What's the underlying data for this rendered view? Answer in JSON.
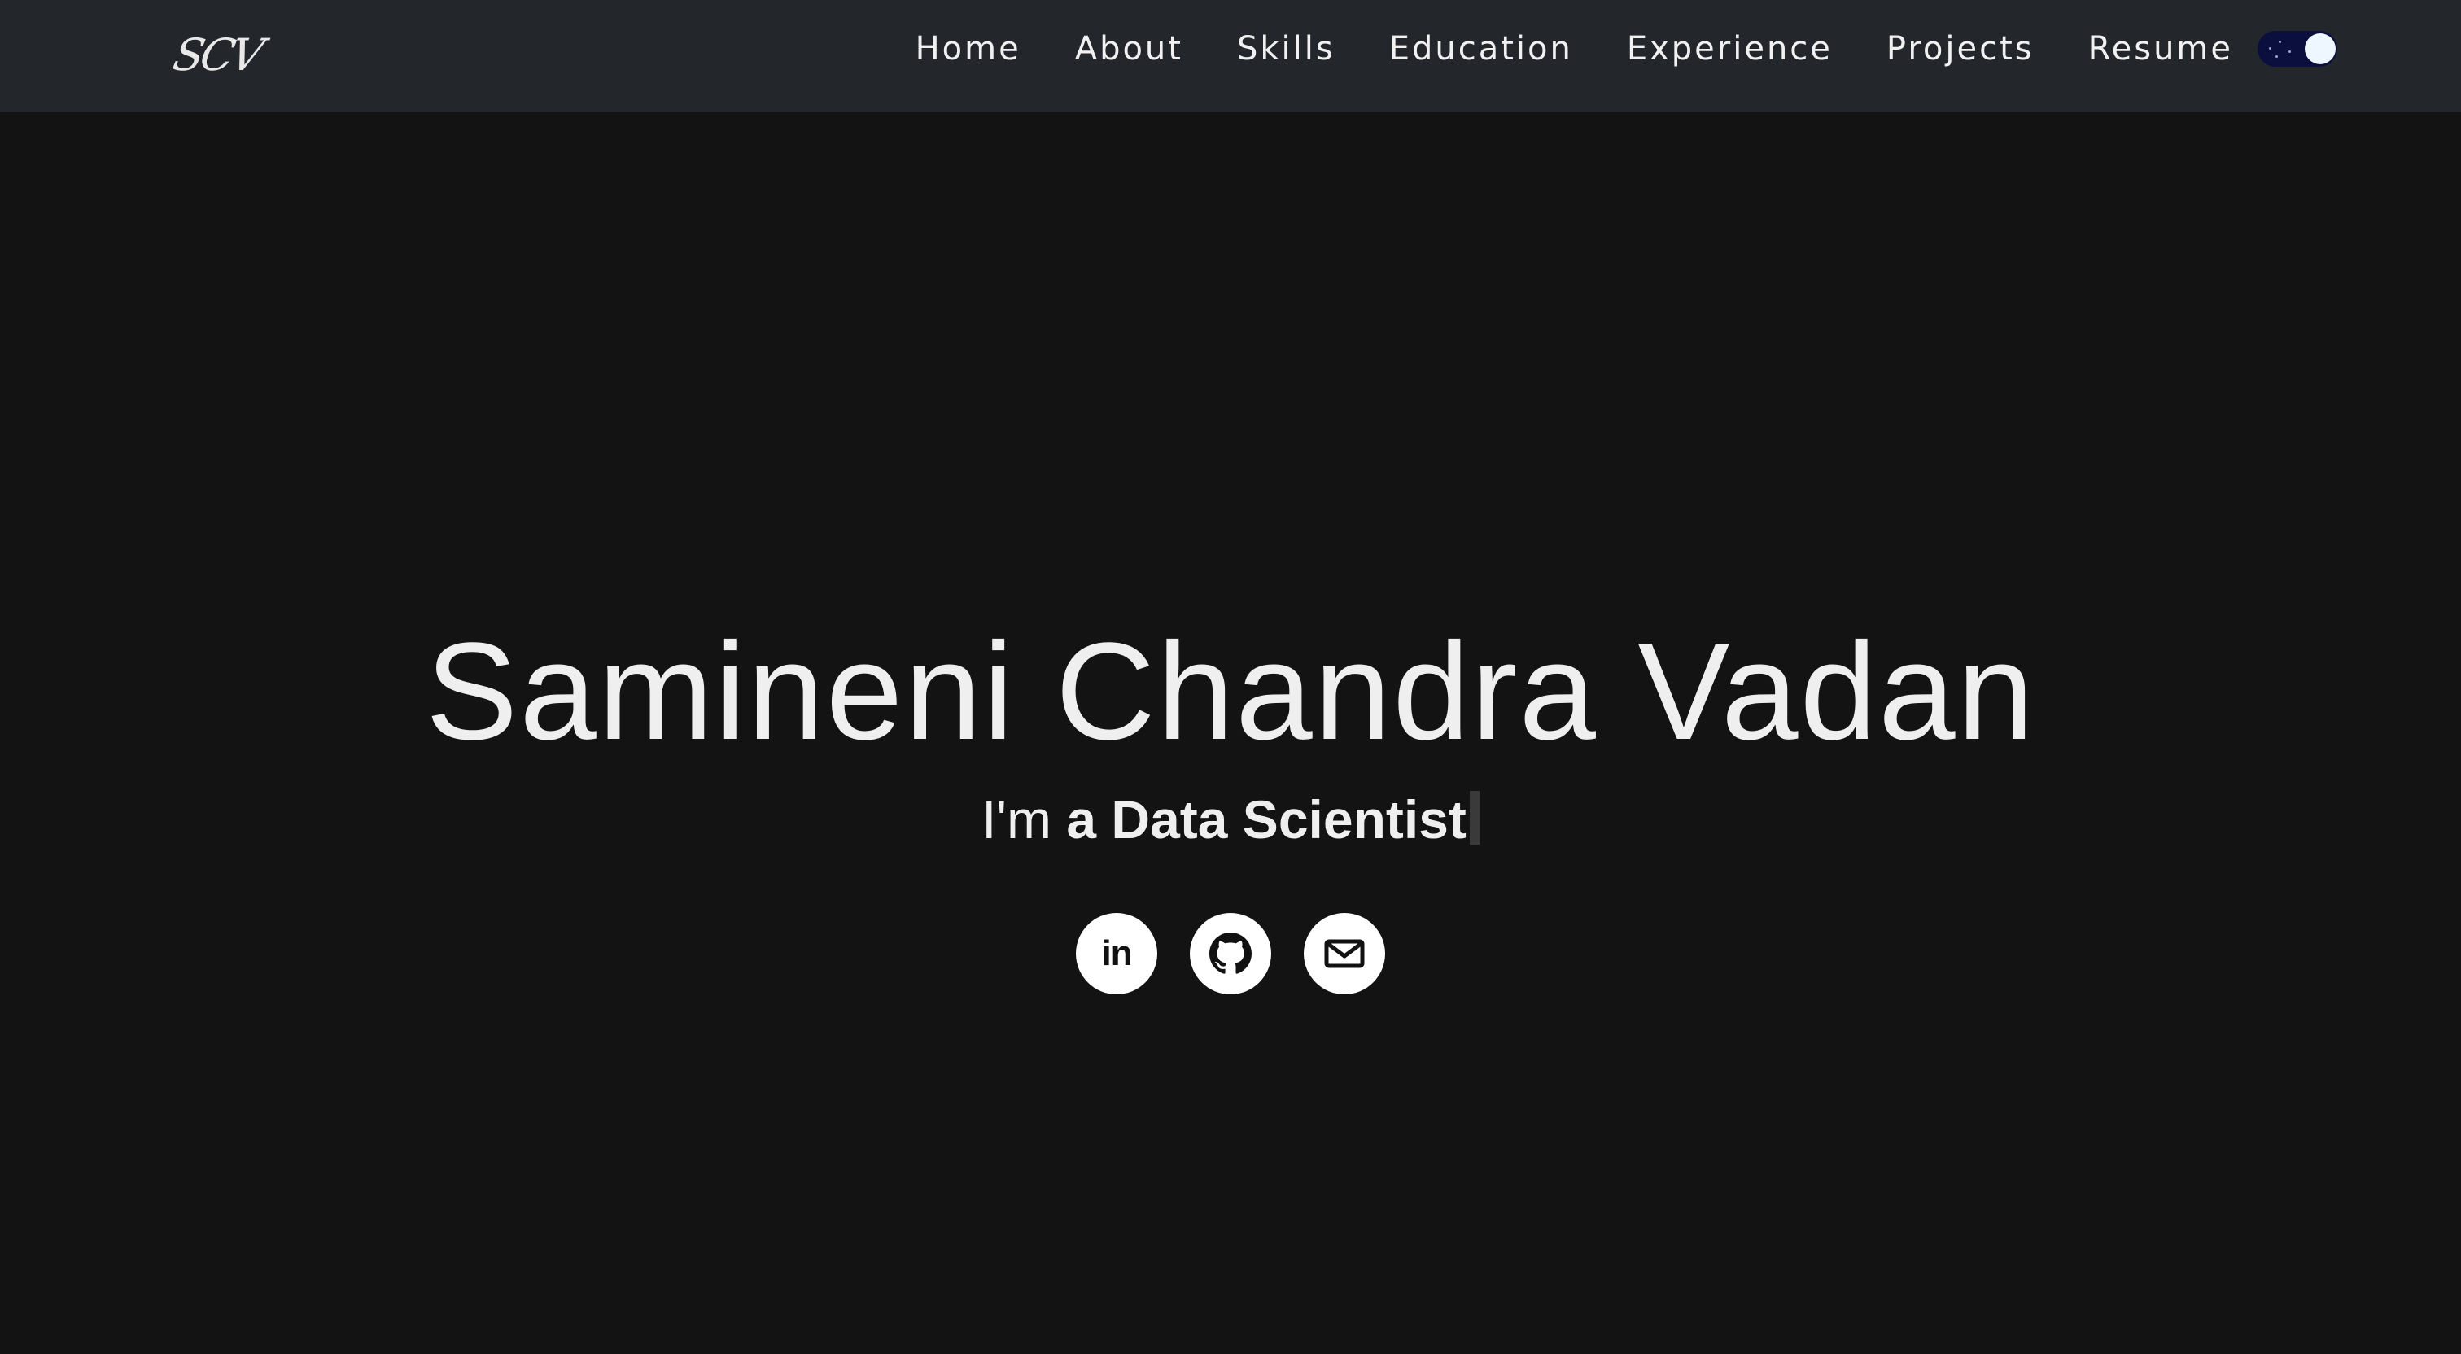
{
  "brand": {
    "logo_text": "SCV"
  },
  "nav": {
    "items": [
      {
        "label": "Home"
      },
      {
        "label": "About"
      },
      {
        "label": "Skills"
      },
      {
        "label": "Education"
      },
      {
        "label": "Experience"
      },
      {
        "label": "Projects"
      },
      {
        "label": "Resume"
      }
    ],
    "theme_toggle": {
      "state": "dark",
      "track_color": "#0b0f3e",
      "knob_color": "#eef6ff"
    }
  },
  "hero": {
    "name": "Samineni Chandra Vadan",
    "tagline_prefix": "I'm ",
    "tagline_role": "a Data Scientist"
  },
  "social": [
    {
      "name": "linkedin",
      "icon": "linkedin-icon",
      "glyph": "in"
    },
    {
      "name": "github",
      "icon": "github-icon"
    },
    {
      "name": "email",
      "icon": "mail-icon"
    }
  ],
  "colors": {
    "page_background": "#131313",
    "navbar_background": "#23272c",
    "text": "#efefef"
  }
}
